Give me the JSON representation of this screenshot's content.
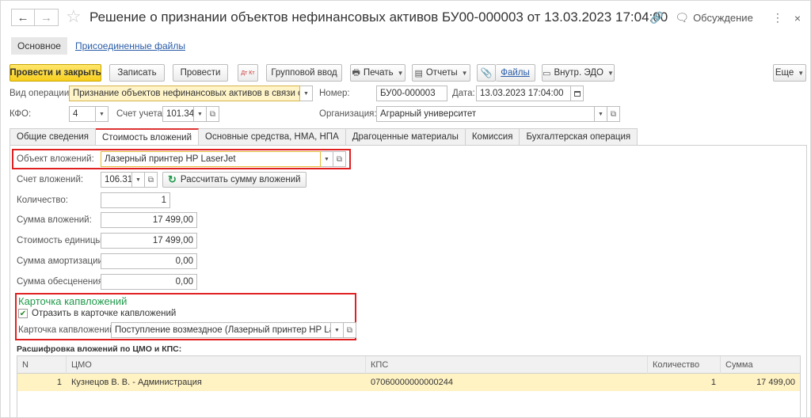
{
  "window": {
    "title": "Решение о признании объектов нефинансовых активов БУ00-000003 от 13.03.2023 17:04:00",
    "discussion_label": "Обсуждение",
    "back_glyph": "←",
    "forward_glyph": "→",
    "star_glyph": "☆",
    "link_glyph": "🔗",
    "chat_glyph": "🗨",
    "more_glyph": "⋮",
    "close_glyph": "×"
  },
  "section_tabs": {
    "main": "Основное",
    "attached_files": "Присоединенные файлы"
  },
  "toolbar": {
    "post_and_close": "Провести и закрыть",
    "save": "Записать",
    "post": "Провести",
    "dt_kt": "Дт Кт",
    "group_input": "Групповой ввод",
    "print": "Печать",
    "reports": "Отчеты",
    "files": "Файлы",
    "internal_edo": "Внутр. ЭДО",
    "more": "Еще",
    "caret": "▼"
  },
  "header": {
    "operation_type_label": "Вид операции:",
    "operation_type_value": "Признание объектов нефинансовых активов в связи с приоб",
    "number_label": "Номер:",
    "number_value": "БУ00-000003",
    "date_label": "Дата:",
    "date_value": "13.03.2023 17:04:00",
    "kfo_label": "КФО:",
    "kfo_value": "4",
    "account_label": "Счет учета:",
    "account_value": "101.34",
    "organization_label": "Организация:",
    "organization_value": "Аграрный университет"
  },
  "content_tabs": [
    "Общие сведения",
    "Стоимость вложений",
    "Основные средства, НМА, НПА",
    "Драгоценные материалы",
    "Комиссия",
    "Бухгалтерская операция"
  ],
  "investment": {
    "object_label": "Объект вложений:",
    "object_value": "Лазерный принтер HP LaserJet",
    "account_label": "Счет вложений:",
    "account_value": "106.31",
    "calc_button": "Рассчитать сумму вложений",
    "quantity_label": "Количество:",
    "quantity_value": "1",
    "sum_label": "Сумма вложений:",
    "sum_value": "17 499,00",
    "unit_cost_label": "Стоимость единицы:",
    "unit_cost_value": "17 499,00",
    "amortization_label": "Сумма амортизации:",
    "amortization_value": "0,00",
    "impairment_label": "Сумма обесценения:",
    "impairment_value": "0,00"
  },
  "capital_card": {
    "heading": "Карточка капвложений",
    "reflect_label": "Отразить в карточке капвложений",
    "reflect_checked": true,
    "card_label": "Карточка капвложений:",
    "card_value": "Поступление возмездное (Лазерный принтер HP LaserJe"
  },
  "breakdown": {
    "caption": "Расшифровка вложений по ЦМО и КПС:",
    "columns": [
      "N",
      "ЦМО",
      "КПС",
      "Количество",
      "Сумма"
    ],
    "rows": [
      {
        "n": "1",
        "cmo": "Кузнецов В. В. - Администрация",
        "kps": "07060000000000244",
        "qty": "1",
        "sum": "17 499,00"
      }
    ]
  }
}
